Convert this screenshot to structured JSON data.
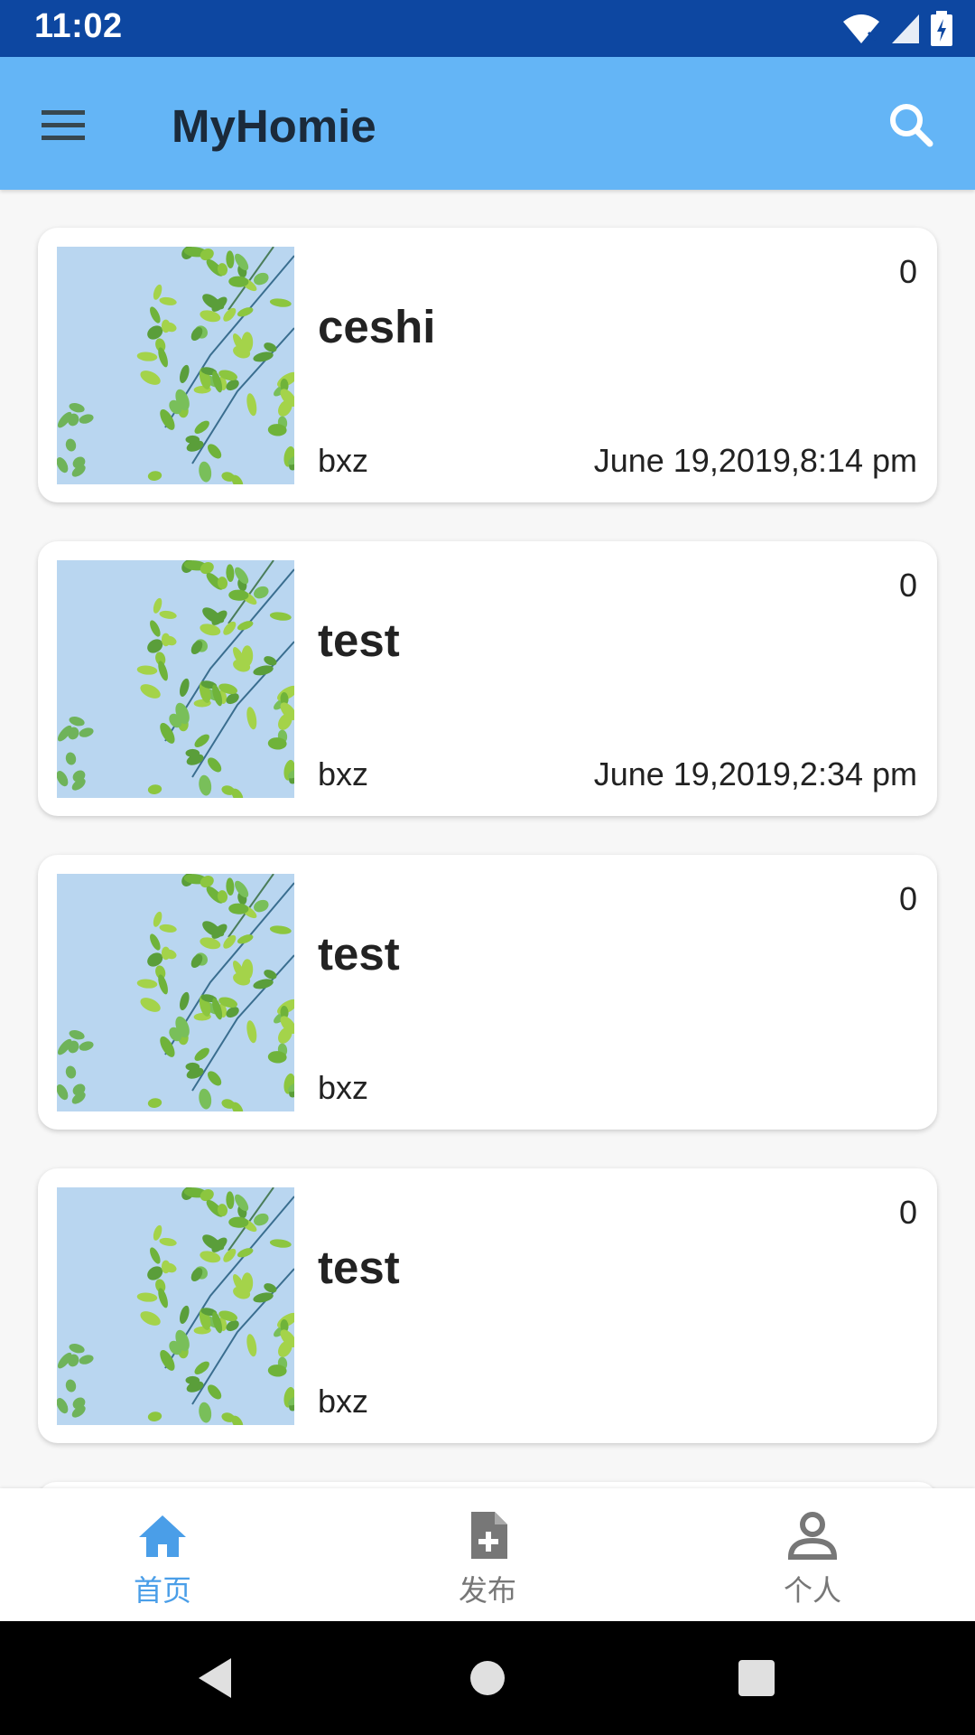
{
  "status_bar": {
    "time": "11:02",
    "icons": [
      "wifi-icon",
      "signal-icon",
      "battery-icon"
    ]
  },
  "app_bar": {
    "title": "MyHomie",
    "left_icon": "menu-icon",
    "right_icon": "search-icon",
    "background": "#64b5f6"
  },
  "posts": [
    {
      "title": "ceshi",
      "author": "bxz",
      "date": "June 19,2019,8:14 pm",
      "count": "0"
    },
    {
      "title": "test",
      "author": "bxz",
      "date": "June 19,2019,2:34 pm",
      "count": "0"
    },
    {
      "title": "test",
      "author": "bxz",
      "date": "",
      "count": "0"
    },
    {
      "title": "test",
      "author": "bxz",
      "date": "",
      "count": "0"
    }
  ],
  "bottom_nav": {
    "items": [
      {
        "label": "首页",
        "icon": "home-icon",
        "active": true
      },
      {
        "label": "发布",
        "icon": "new-document-icon",
        "active": false
      },
      {
        "label": "个人",
        "icon": "person-icon",
        "active": false
      }
    ],
    "active_color": "#4a9ee8"
  },
  "system_nav": {
    "icons": [
      "back-icon",
      "home-circle-icon",
      "recents-icon"
    ]
  }
}
